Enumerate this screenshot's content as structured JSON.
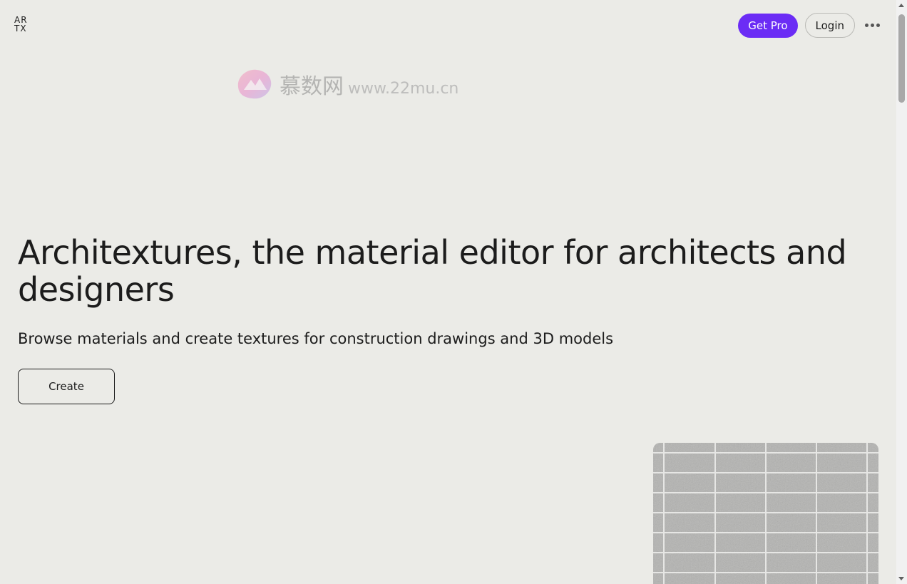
{
  "header": {
    "logo_line1": "AR",
    "logo_line2": "TX",
    "get_pro_label": "Get Pro",
    "login_label": "Login",
    "more_icon": "more-horizontal-icon"
  },
  "watermark": {
    "chinese_text": "慕数网",
    "url_text": "www.22mu.cn"
  },
  "hero": {
    "title": "Architextures, the material editor for architects and designers",
    "subtitle": "Browse materials and create textures for construction drawings and 3D models",
    "create_label": "Create"
  },
  "colors": {
    "background": "#ebebe7",
    "accent": "#6b2cf5",
    "text": "#1c1c1c"
  }
}
